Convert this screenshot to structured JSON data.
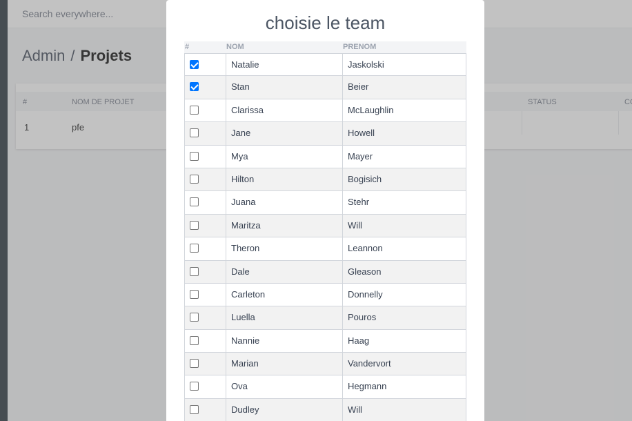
{
  "topbar": {
    "search_placeholder": "Search everywhere..."
  },
  "breadcrumb": {
    "root": "Admin",
    "separator": "/",
    "current": "Projets"
  },
  "projects_table": {
    "columns": [
      "#",
      "NOM DE PROJET",
      "STATUS",
      "CO"
    ],
    "rows": [
      {
        "num": "1",
        "name": "pfe"
      }
    ]
  },
  "modal": {
    "title": "choisie le team",
    "columns": [
      "#",
      "NOM",
      "PRENOM"
    ],
    "members": [
      {
        "nom": "Natalie",
        "prenom": "Jaskolski",
        "checked": true
      },
      {
        "nom": "Stan",
        "prenom": "Beier",
        "checked": true
      },
      {
        "nom": "Clarissa",
        "prenom": "McLaughlin",
        "checked": false
      },
      {
        "nom": "Jane",
        "prenom": "Howell",
        "checked": false
      },
      {
        "nom": "Mya",
        "prenom": "Mayer",
        "checked": false
      },
      {
        "nom": "Hilton",
        "prenom": "Bogisich",
        "checked": false
      },
      {
        "nom": "Juana",
        "prenom": "Stehr",
        "checked": false
      },
      {
        "nom": "Maritza",
        "prenom": "Will",
        "checked": false
      },
      {
        "nom": "Theron",
        "prenom": "Leannon",
        "checked": false
      },
      {
        "nom": "Dale",
        "prenom": "Gleason",
        "checked": false
      },
      {
        "nom": "Carleton",
        "prenom": "Donnelly",
        "checked": false
      },
      {
        "nom": "Luella",
        "prenom": "Pouros",
        "checked": false
      },
      {
        "nom": "Nannie",
        "prenom": "Haag",
        "checked": false
      },
      {
        "nom": "Marian",
        "prenom": "Vandervort",
        "checked": false
      },
      {
        "nom": "Ova",
        "prenom": "Hegmann",
        "checked": false
      },
      {
        "nom": "Dudley",
        "prenom": "Will",
        "checked": false
      }
    ]
  }
}
